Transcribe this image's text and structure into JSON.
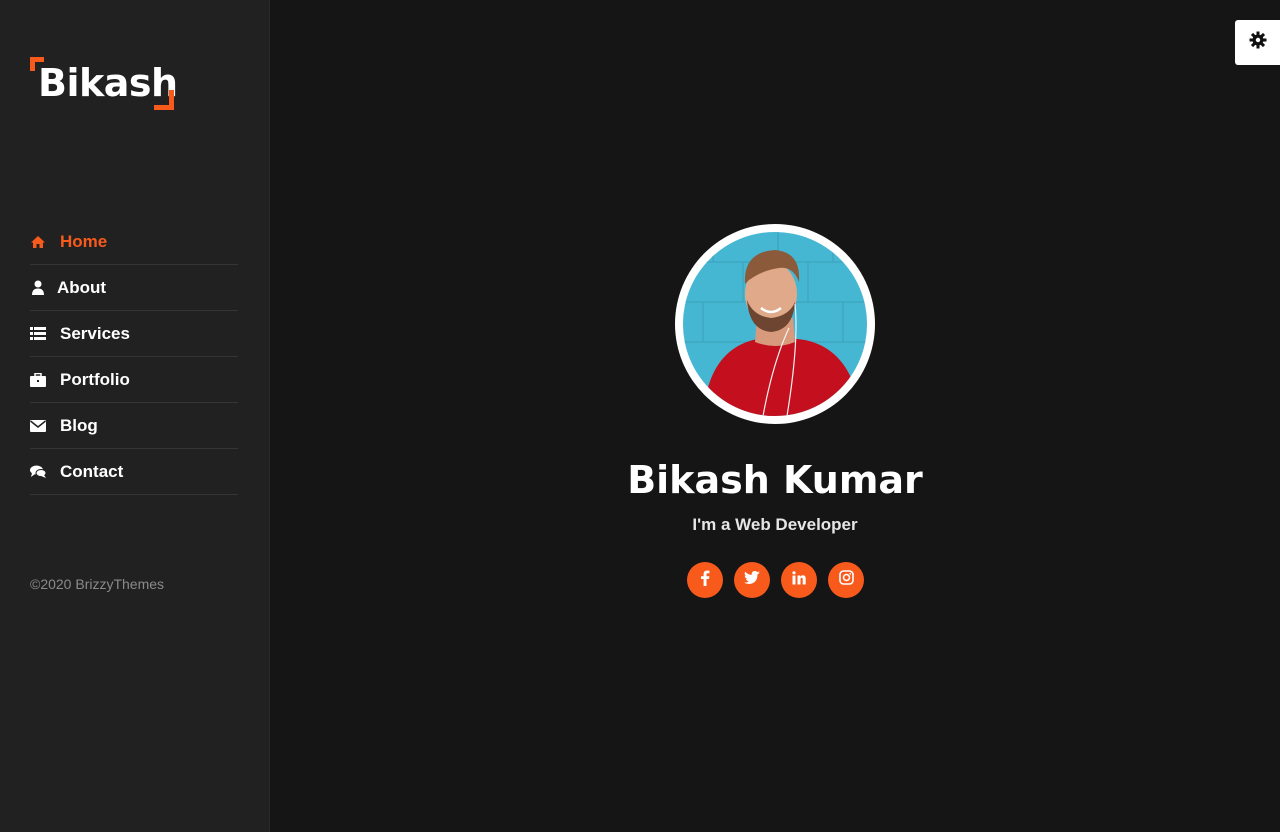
{
  "brand": {
    "logo_text": "Bikash",
    "accent_color": "#f85a1c"
  },
  "nav": {
    "items": [
      {
        "label": "Home",
        "icon": "home-icon",
        "active": true
      },
      {
        "label": "About",
        "icon": "user-icon",
        "active": false
      },
      {
        "label": "Services",
        "icon": "list-icon",
        "active": false
      },
      {
        "label": "Portfolio",
        "icon": "briefcase-icon",
        "active": false
      },
      {
        "label": "Blog",
        "icon": "envelope-icon",
        "active": false
      },
      {
        "label": "Contact",
        "icon": "comments-icon",
        "active": false
      }
    ]
  },
  "footer": {
    "copyright": "©2020 BrizzyThemes"
  },
  "settings": {
    "icon": "gear-icon"
  },
  "hero": {
    "name": "Bikash Kumar",
    "role": "I'm a Web Developer",
    "avatar_icon": "profile-photo"
  },
  "socials": [
    {
      "icon": "facebook-icon"
    },
    {
      "icon": "twitter-icon"
    },
    {
      "icon": "linkedin-icon"
    },
    {
      "icon": "instagram-icon"
    }
  ]
}
